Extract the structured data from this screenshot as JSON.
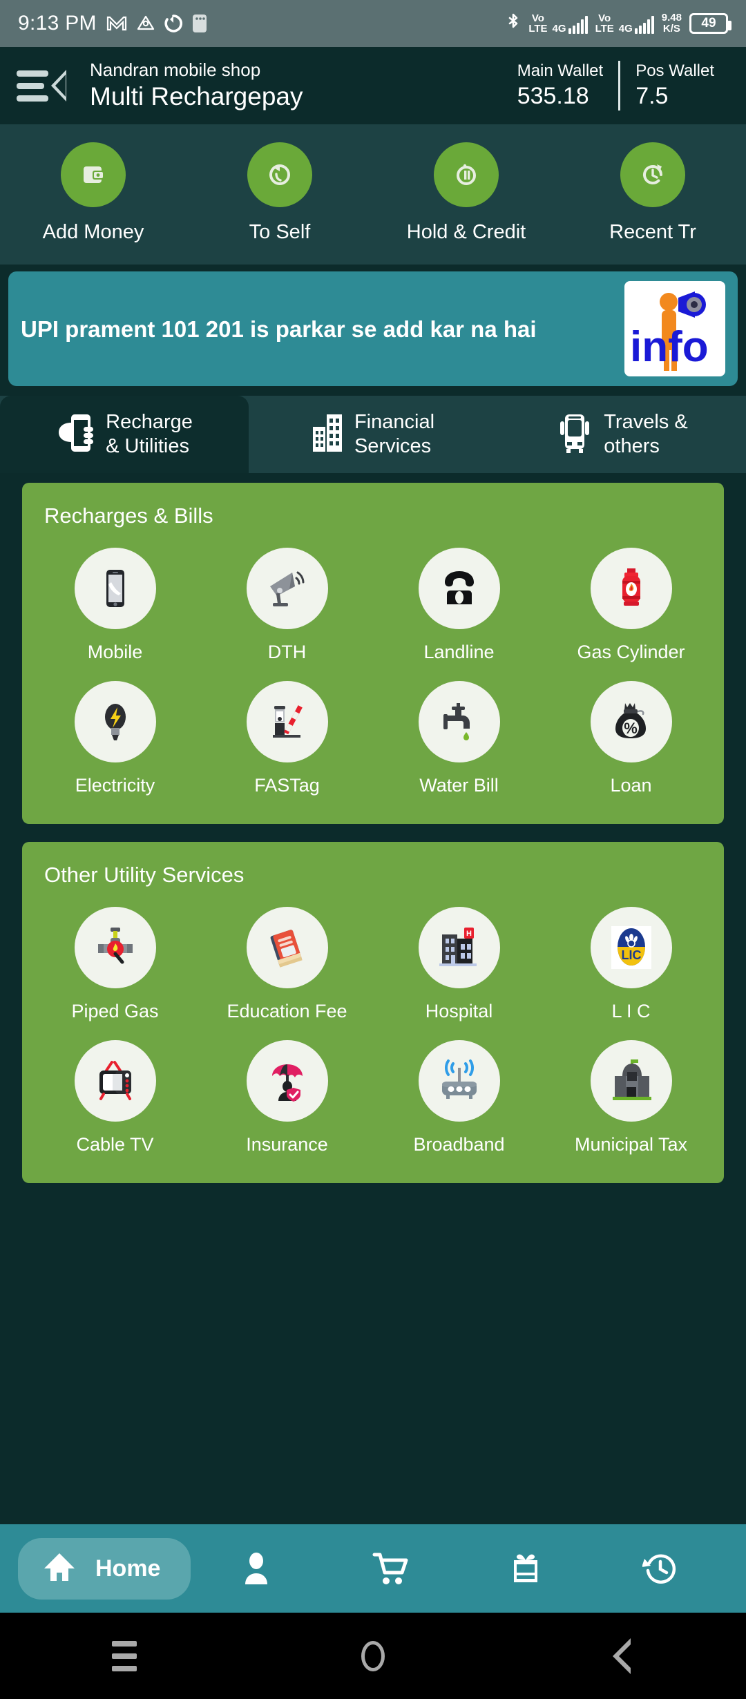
{
  "statusbar": {
    "time": "9:13 PM",
    "left_icons": [
      "gmail-icon",
      "drive-icon",
      "sync-icon",
      "sim-icon"
    ],
    "bluetooth": "bluetooth-icon",
    "sim1_network": "4G",
    "sim1_volte": "Vo\nLTE",
    "sim2_network": "4G",
    "sim2_volte": "Vo\nLTE",
    "volte_top": "Vo",
    "volte_bottom": "LTE",
    "data_speed_value": "9.48",
    "data_speed_unit": "K/S",
    "battery": "49"
  },
  "appbar": {
    "menu_icon": "hamburger-back-icon",
    "shop_name": "Nandran mobile shop",
    "app_title": "Multi Rechargepay",
    "wallets": [
      {
        "label": "Main Wallet",
        "value": "535.18"
      },
      {
        "label": "Pos Wallet",
        "value": "7.5"
      }
    ]
  },
  "quick_actions": [
    {
      "label": "Add Money",
      "icon": "wallet-icon"
    },
    {
      "label": "To Self",
      "icon": "refresh-arrow-icon"
    },
    {
      "label": "Hold & Credit",
      "icon": "pause-circle-icon"
    },
    {
      "label": "Recent Tr",
      "icon": "clock-arrow-icon"
    }
  ],
  "banner": {
    "text": "UPI prament 101 201 is parkar se add kar na hai",
    "image_label": "info",
    "image_alt": "info-megaphone-icon"
  },
  "tabs": [
    {
      "label_line1": "Recharge",
      "label_line2": "& Utilities",
      "icon": "hand-phone-icon",
      "active": true
    },
    {
      "label_line1": "Financial",
      "label_line2": "Services",
      "icon": "buildings-icon",
      "active": false
    },
    {
      "label_line1": "Travels &",
      "label_line2": "others",
      "icon": "bus-icon",
      "active": false
    }
  ],
  "sections": [
    {
      "title": "Recharges & Bills",
      "items": [
        {
          "label": "Mobile",
          "icon": "mobile-phone-icon"
        },
        {
          "label": "DTH",
          "icon": "satellite-dish-icon"
        },
        {
          "label": "Landline",
          "icon": "landline-phone-icon"
        },
        {
          "label": "Gas Cylinder",
          "icon": "gas-cylinder-icon"
        },
        {
          "label": "Electricity",
          "icon": "light-bulb-icon"
        },
        {
          "label": "FASTag",
          "icon": "toll-barrier-icon"
        },
        {
          "label": "Water Bill",
          "icon": "water-tap-icon"
        },
        {
          "label": "Loan",
          "icon": "money-bag-percent-icon"
        }
      ]
    },
    {
      "title": "Other Utility Services",
      "items": [
        {
          "label": "Piped Gas",
          "icon": "gas-valve-icon"
        },
        {
          "label": "Education Fee",
          "icon": "books-icon"
        },
        {
          "label": "Hospital",
          "icon": "hospital-building-icon"
        },
        {
          "label": "L I C",
          "icon": "lic-logo-icon"
        },
        {
          "label": "Cable TV",
          "icon": "television-icon"
        },
        {
          "label": "Insurance",
          "icon": "umbrella-shield-icon"
        },
        {
          "label": "Broadband",
          "icon": "wifi-router-icon"
        },
        {
          "label": "Municipal Tax",
          "icon": "government-building-icon"
        }
      ]
    }
  ],
  "bottom_nav": {
    "home_label": "Home",
    "items": [
      {
        "icon": "home-icon",
        "label": "Home",
        "active": true
      },
      {
        "icon": "person-icon",
        "label": "",
        "active": false
      },
      {
        "icon": "cart-icon",
        "label": "",
        "active": false
      },
      {
        "icon": "gift-icon",
        "label": "",
        "active": false
      },
      {
        "icon": "history-clock-icon",
        "label": "",
        "active": false
      }
    ]
  },
  "android_nav": [
    {
      "icon": "recents-icon"
    },
    {
      "icon": "home-circle-icon"
    },
    {
      "icon": "back-triangle-icon"
    }
  ],
  "colors": {
    "status_bar": "#5b7072",
    "app_bar": "#0c2b2b",
    "quick_band": "#1d4244",
    "accent_green": "#6aa939",
    "card_green": "#6fa644",
    "banner_teal": "#2e8b95",
    "nav_teal": "#2e8b96",
    "nav_pill": "#5aa6ad"
  }
}
